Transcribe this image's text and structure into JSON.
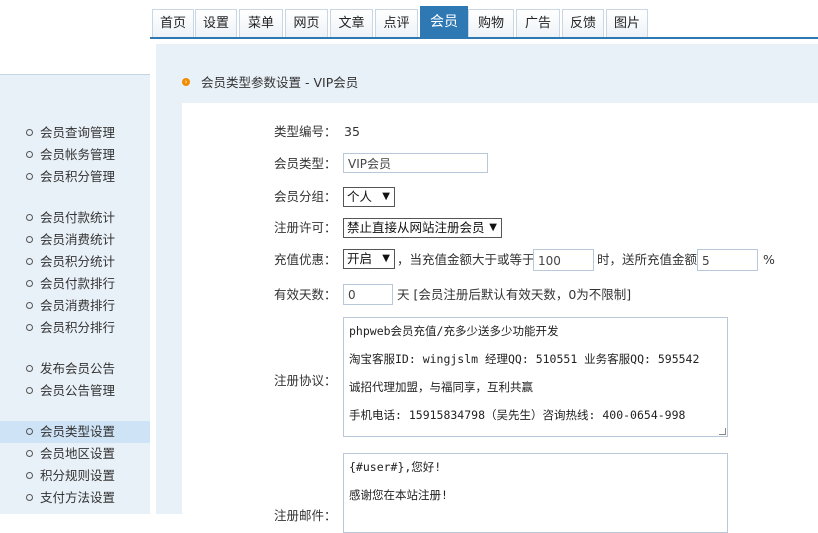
{
  "tabs": [
    "首页",
    "设置",
    "菜单",
    "网页",
    "文章",
    "点评",
    "会员",
    "购物",
    "广告",
    "反馈",
    "图片"
  ],
  "active_tab": "会员",
  "sidebar": {
    "groups": [
      [
        "会员查询管理",
        "会员帐务管理",
        "会员积分管理"
      ],
      [
        "会员付款统计",
        "会员消费统计",
        "会员积分统计",
        "会员付款排行",
        "会员消费排行",
        "会员积分排行"
      ],
      [
        "发布会员公告",
        "会员公告管理"
      ],
      [
        "会员类型设置",
        "会员地区设置",
        "积分规则设置",
        "支付方法设置"
      ]
    ],
    "active": "会员类型设置"
  },
  "section": {
    "title": "会员类型参数设置 - VIP会员"
  },
  "form": {
    "type_id_label": "类型编号：",
    "type_id_value": "35",
    "type_name_label": "会员类型：",
    "type_name_value": "VIP会员",
    "group_label": "会员分组：",
    "group_value": "个人",
    "reg_label": "注册许可：",
    "reg_value": "禁止直接从网站注册会员",
    "recharge_label": "充值优惠：",
    "recharge_value": "开启",
    "recharge_text1": "，当充值金额大于或等于",
    "recharge_amount": "100",
    "recharge_text2": "时，送所充值金额",
    "recharge_percent": "5",
    "recharge_unit": "%",
    "days_label": "有效天数：",
    "days_value": "0",
    "days_hint": "天 [会员注册后默认有效天数，0为不限制]",
    "agreement_label": "注册协议：",
    "agreement_lines": [
      "phpweb会员充值/充多少送多少功能开发",
      "淘宝客服ID: wingjslm 经理QQ: 510551 业务客服QQ: 595542",
      "诚招代理加盟，与福同享，互利共赢",
      "手机电话: 15915834798（吴先生）咨询热线: 400-0654-998"
    ],
    "welcome_label": "注册邮件：",
    "welcome_lines": [
      "{#user#},您好!",
      "感谢您在本站注册!"
    ]
  }
}
